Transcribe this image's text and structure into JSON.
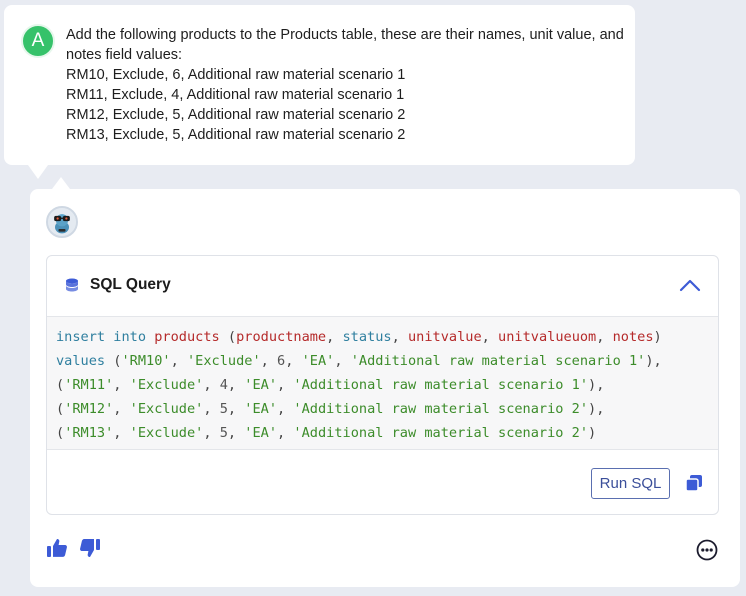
{
  "user_message": {
    "avatar_letter": "A",
    "lines": [
      "Add the following products to the Products table, these are their names, unit value, and",
      "notes field values:",
      "RM10, Exclude, 6, Additional raw material scenario 1",
      "RM11, Exclude, 4, Additional raw material scenario 1",
      "RM12, Exclude, 5, Additional raw material scenario 2",
      "RM13, Exclude, 5, Additional raw material scenario 2"
    ]
  },
  "sql_panel": {
    "title": "SQL Query",
    "code": {
      "insert": "insert",
      "into": "into",
      "table": "products",
      "cols": [
        "productname",
        "status",
        "unitvalue",
        "unitvalueuom",
        "notes"
      ],
      "values_kw": "values",
      "rows": [
        [
          "'RM10'",
          "'Exclude'",
          "6",
          "'EA'",
          "'Additional raw material scenario 1'"
        ],
        [
          "'RM11'",
          "'Exclude'",
          "4",
          "'EA'",
          "'Additional raw material scenario 1'"
        ],
        [
          "'RM12'",
          "'Exclude'",
          "5",
          "'EA'",
          "'Additional raw material scenario 2'"
        ],
        [
          "'RM13'",
          "'Exclude'",
          "5",
          "'EA'",
          "'Additional raw material scenario 2'"
        ]
      ]
    },
    "run_button": "Run SQL"
  },
  "icons": {
    "database": "database-icon",
    "collapse": "chevron-up-icon",
    "copy": "copy-icon",
    "like": "thumbs-up-icon",
    "dislike": "thumbs-down-icon",
    "more": "more-options-icon"
  },
  "colors": {
    "accent": "#3b4f9a",
    "avatar_green": "#36c26a",
    "icon_blue": "#3d5bd6"
  }
}
